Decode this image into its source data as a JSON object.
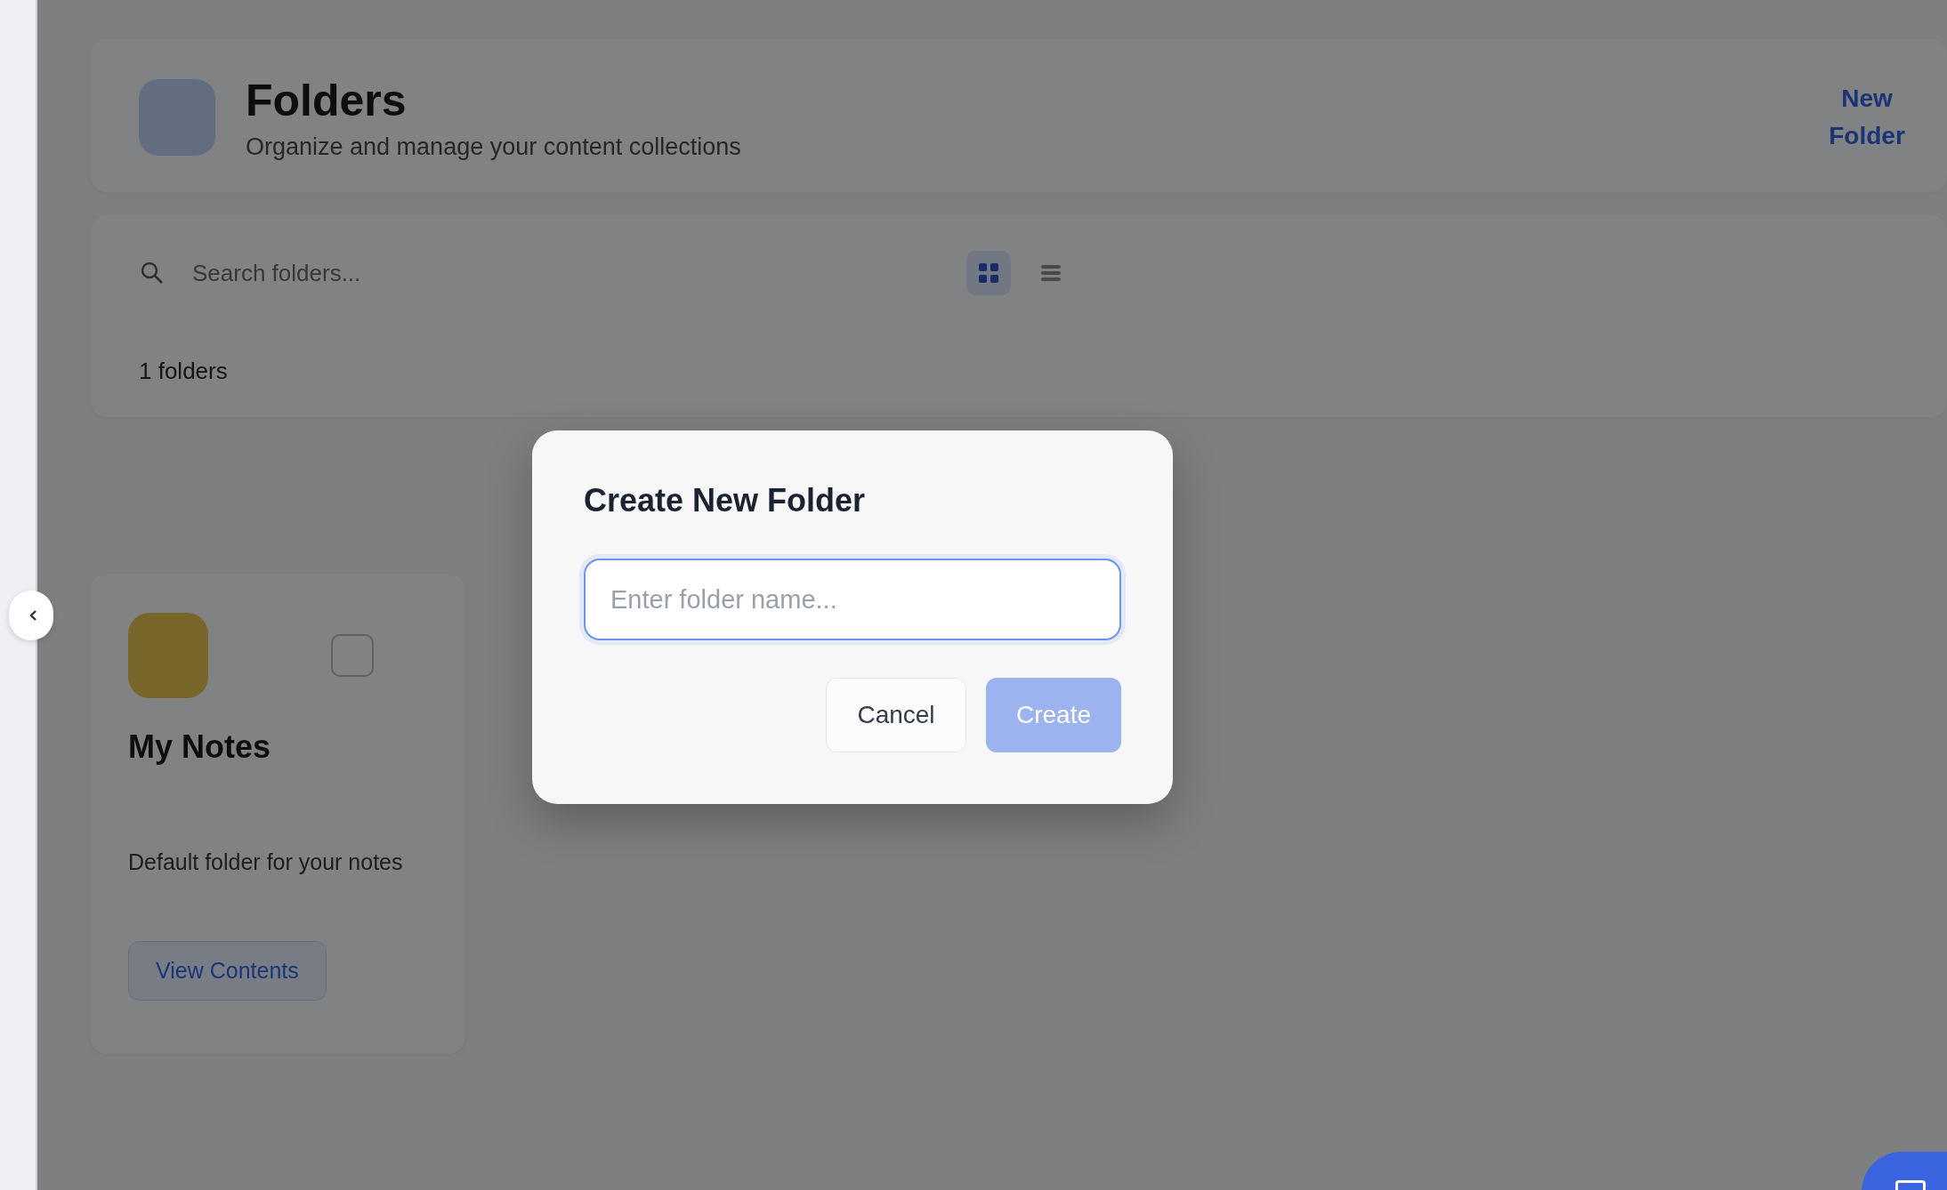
{
  "header": {
    "title": "Folders",
    "subtitle": "Organize and manage your content collections",
    "new_button": "New Folder"
  },
  "toolbar": {
    "search_placeholder": "Search folders...",
    "views": [
      {
        "kind": "grid",
        "selected": true
      },
      {
        "kind": "list",
        "selected": false
      }
    ]
  },
  "count": "1 folders",
  "folders": [
    {
      "name": "My Notes",
      "checked": false,
      "description": "Default folder for your notes",
      "open_button": "View Contents"
    }
  ],
  "dialog": {
    "title": "Create New Folder",
    "placeholder": "Enter folder name...",
    "cancel": "Cancel",
    "create": "Create",
    "create_disabled": true
  }
}
